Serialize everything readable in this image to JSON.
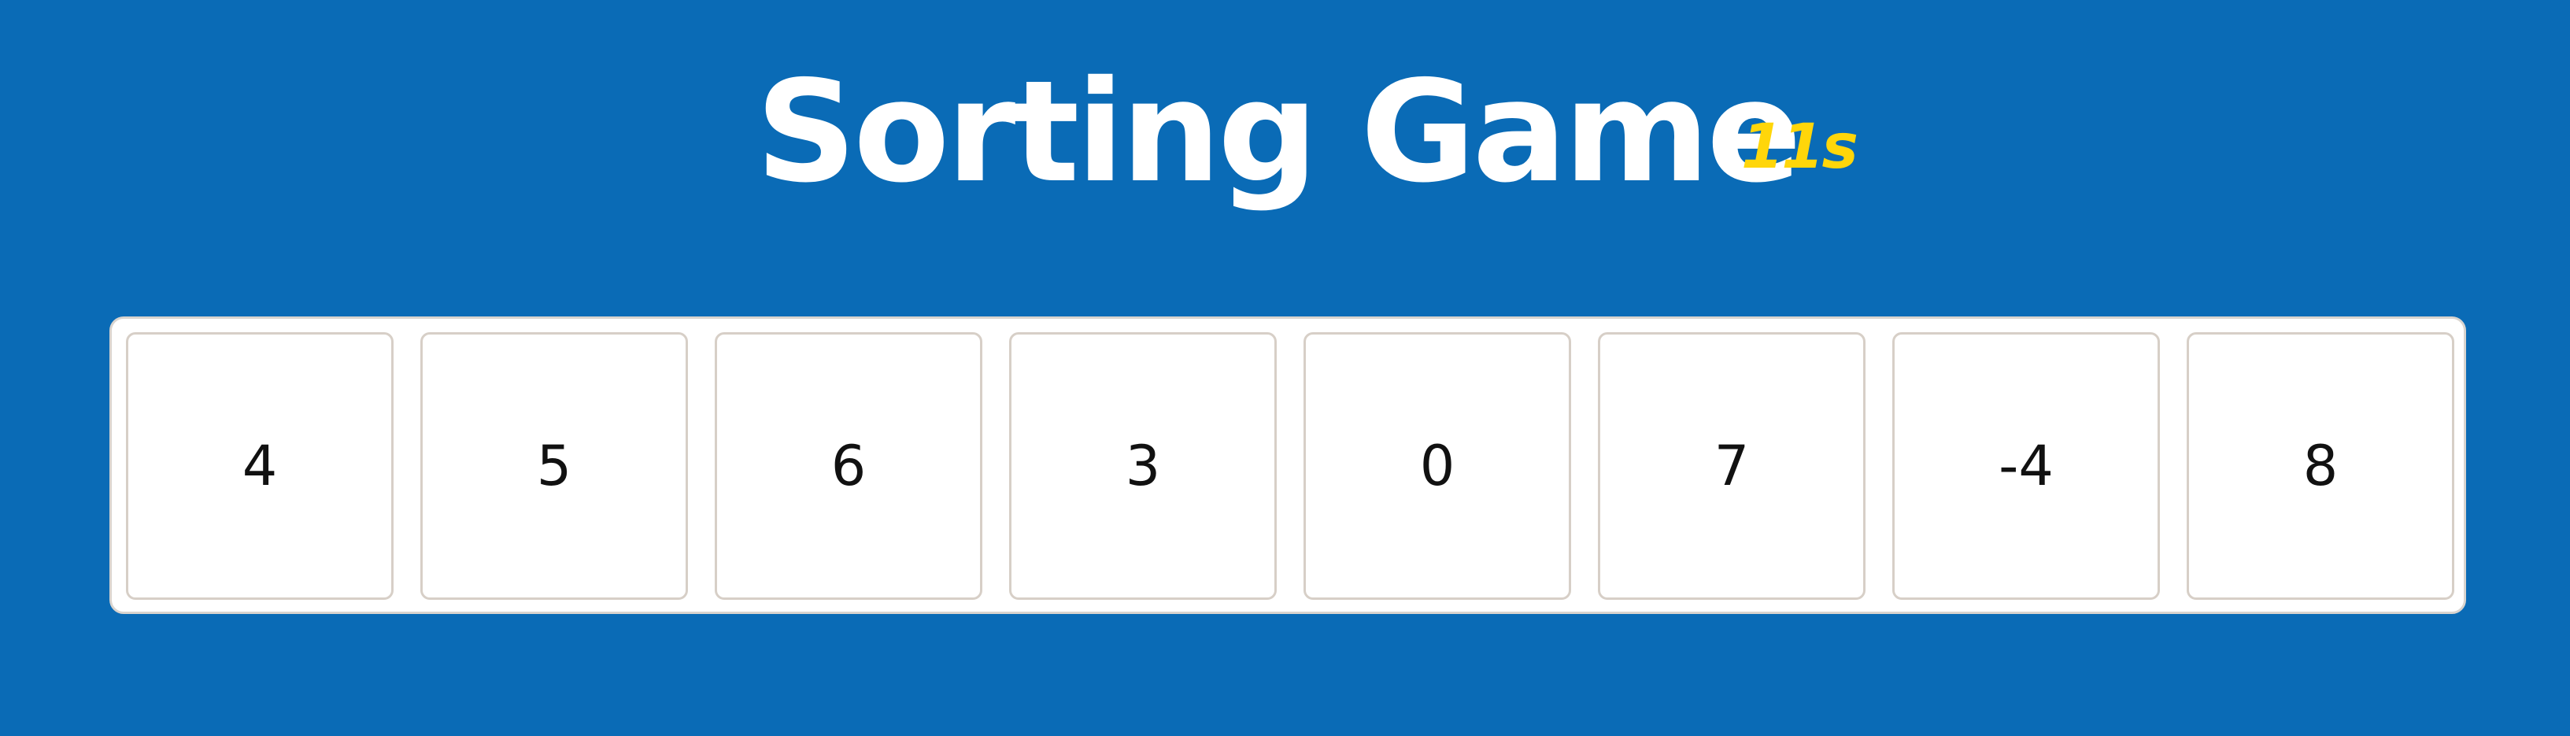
{
  "header": {
    "title": "Sorting Game",
    "timer": "11s"
  },
  "board": {
    "tiles": [
      "4",
      "5",
      "6",
      "3",
      "0",
      "7",
      "-4",
      "8"
    ]
  },
  "colors": {
    "background": "#0a6bb6",
    "title": "#ffffff",
    "timer": "#ffd60a",
    "board": "#ffffff",
    "tile_border": "#d7cfc7"
  }
}
